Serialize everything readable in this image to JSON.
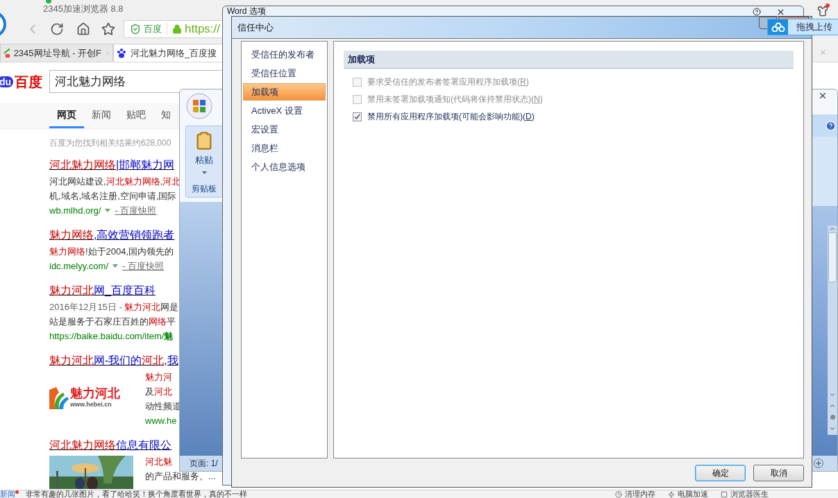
{
  "browser": {
    "title": "2345加速浏览器 8.8",
    "address": {
      "site_badge": "百度",
      "url": "https://"
    },
    "tabs": [
      {
        "label": "2345网址导航 - 开创F",
        "selected": false
      },
      {
        "label": "河北魅力网络_百度搜",
        "selected": true
      }
    ],
    "logo": {
      "paw_text": "du",
      "text": "百度"
    },
    "search": {
      "value": "河北魅力网络"
    },
    "nav_tabs": [
      {
        "label": "网页",
        "selected": true
      },
      {
        "label": "新闻",
        "selected": false
      },
      {
        "label": "贴吧",
        "selected": false
      },
      {
        "label": "知",
        "selected": false
      }
    ],
    "result_count": "百度为您找到相关结果约628,000",
    "results": [
      {
        "title": [
          {
            "text": "河北魅力网络",
            "kind": "hit"
          },
          {
            "text": "|邯郸魅力网",
            "kind": "plain"
          }
        ],
        "kind": "text",
        "lines": [
          [
            {
              "text": "河北网站建设,",
              "kind": "plain"
            },
            {
              "text": "河北魅力网络",
              "kind": "hit"
            },
            {
              "text": ",",
              "kind": "plain"
            },
            {
              "text": "河北",
              "kind": "hit"
            }
          ],
          [
            {
              "text": "机,域名,域名注册,空间申请,国际",
              "kind": "plain"
            }
          ]
        ],
        "url": [
          {
            "text": "wb.mlhd.org/",
            "kind": "plain"
          }
        ],
        "snapshot": "- 百度快照"
      },
      {
        "title": [
          {
            "text": "魅力网络",
            "kind": "hit"
          },
          {
            "text": ",高效营销领跑者",
            "kind": "plain"
          }
        ],
        "kind": "text",
        "lines": [
          [
            {
              "text": "魅力网络",
              "kind": "hit"
            },
            {
              "text": "!始于2004,国内领先的",
              "kind": "plain"
            }
          ]
        ],
        "url": [
          {
            "text": "idc.melyy.com/",
            "kind": "plain"
          }
        ],
        "snapshot": "- 百度快照"
      },
      {
        "title": [
          {
            "text": "魅力河北",
            "kind": "hit"
          },
          {
            "text": "网_百度百科",
            "kind": "plain"
          }
        ],
        "kind": "text",
        "lines": [
          [
            {
              "text": "2016年12月15日 - ",
              "kind": "date"
            },
            {
              "text": "魅力河北",
              "kind": "hit"
            },
            {
              "text": "网是",
              "kind": "plain"
            }
          ],
          [
            {
              "text": "站是服务于石家庄百姓的",
              "kind": "plain"
            },
            {
              "text": "网络",
              "kind": "hit"
            },
            {
              "text": "平",
              "kind": "plain"
            }
          ]
        ],
        "url": [
          {
            "text": "https://baike.baidu.com/item/",
            "kind": "plain"
          },
          {
            "text": "魅",
            "kind": "hit"
          }
        ]
      },
      {
        "title": [
          {
            "text": "魅力河北",
            "kind": "hit"
          },
          {
            "text": "网-我们的",
            "kind": "plain"
          },
          {
            "text": "河北",
            "kind": "hit"
          },
          {
            "text": ",我",
            "kind": "plain"
          }
        ],
        "kind": "logo",
        "logo_text": "魅力河北",
        "logo_url": "www.hebei.cn",
        "lines": [
          [
            {
              "text": "魅力河",
              "kind": "hit"
            }
          ],
          [
            {
              "text": "及",
              "kind": "plain"
            },
            {
              "text": "河北",
              "kind": "hit"
            }
          ],
          [
            {
              "text": "动性频道",
              "kind": "plain"
            }
          ]
        ],
        "url": [
          {
            "text": "www.he",
            "kind": "plain"
          }
        ]
      },
      {
        "title": [
          {
            "text": "河北魅力网络",
            "kind": "hit"
          },
          {
            "text": "信息有限公",
            "kind": "plain"
          }
        ],
        "kind": "picture",
        "lines": [
          [
            {
              "text": "河北魅",
              "kind": "hit"
            }
          ],
          [
            {
              "text": "的产品和服务。",
              "kind": "plain"
            },
            {
              "text": "...",
              "kind": "more"
            }
          ]
        ]
      }
    ],
    "status_bar": {
      "news": "新闻",
      "headline": "非常有趣的几张图片，看了哈哈笑！换个角度看世界，真的不一样",
      "tools": [
        "清理内存",
        "电脑加速",
        "浏览器医生"
      ]
    }
  },
  "word": {
    "paste": "粘贴",
    "group": "剪贴板",
    "status": "页面: 1/"
  },
  "options_dialog": {
    "title": "Word 选项"
  },
  "trust_center": {
    "title": "信任中心",
    "nav": [
      {
        "label": "受信任的发布者",
        "selected": false
      },
      {
        "label": "受信任位置",
        "selected": false
      },
      {
        "label": "加载项",
        "selected": true
      },
      {
        "label": "ActiveX 设置",
        "selected": false
      },
      {
        "label": "宏设置",
        "selected": false
      },
      {
        "label": "消息栏",
        "selected": false
      },
      {
        "label": "个人信息选项",
        "selected": false
      }
    ],
    "section": "加载项",
    "options": [
      {
        "before": "要求受信任的发布者签署应用程序加载项(",
        "key": "R",
        "after": ")",
        "checked": false,
        "disabled": true
      },
      {
        "before": "禁用未签署加载项通知(代码将保持禁用状态)(",
        "key": "N",
        "after": ")",
        "checked": false,
        "disabled": true
      },
      {
        "before": "禁用所有应用程序加载项(可能会影响功能)(",
        "key": "D",
        "after": ")",
        "checked": true,
        "disabled": false
      }
    ],
    "buttons": [
      {
        "label": "确定",
        "default": true
      },
      {
        "label": "取消",
        "default": false
      }
    ]
  },
  "upload_widget": {
    "label": "拖拽上传"
  }
}
